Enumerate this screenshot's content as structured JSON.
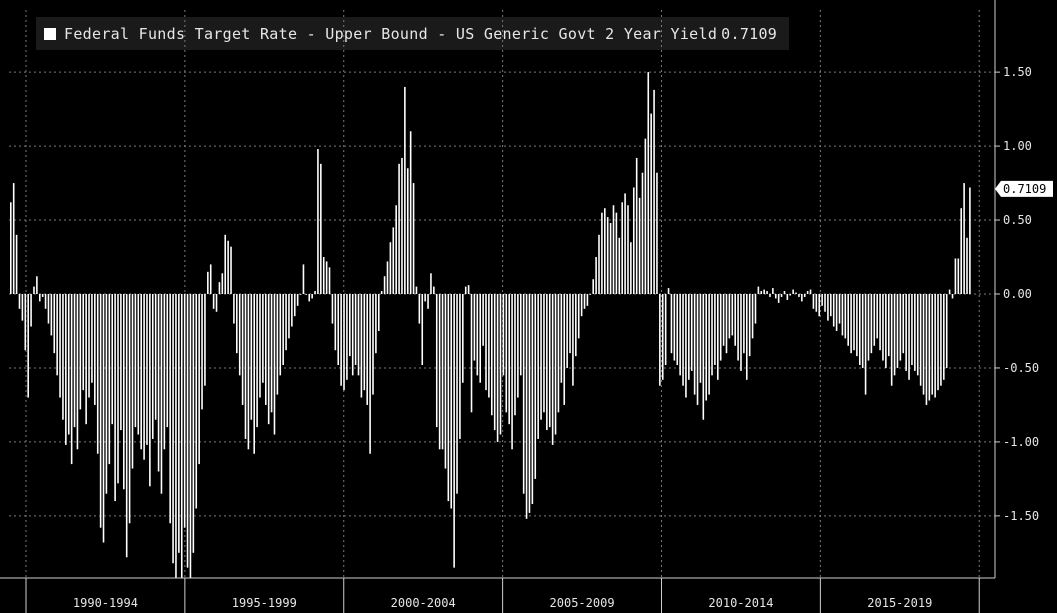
{
  "chart_data": {
    "type": "bar",
    "series": [
      {
        "name": "Federal Funds Target Rate - Upper Bound - US Generic Govt 2 Year Yield",
        "last_value": "0.7109",
        "color": "#ffffff",
        "values": [
          0.62,
          0.75,
          0.4,
          -0.1,
          -0.18,
          -0.38,
          -0.7,
          -0.22,
          0.05,
          0.12,
          -0.05,
          -0.02,
          -0.1,
          -0.2,
          -0.28,
          -0.4,
          -0.55,
          -0.7,
          -0.85,
          -1.02,
          -0.95,
          -1.15,
          -0.9,
          -1.05,
          -0.78,
          -0.65,
          -0.88,
          -0.7,
          -0.6,
          -0.75,
          -1.08,
          -1.58,
          -1.68,
          -1.35,
          -1.15,
          -0.88,
          -1.4,
          -1.28,
          -0.92,
          -1.32,
          -1.78,
          -1.55,
          -1.18,
          -0.9,
          -0.95,
          -1.05,
          -1.12,
          -1.02,
          -1.3,
          -0.98,
          -0.85,
          -1.2,
          -1.35,
          -1.05,
          -0.9,
          -1.55,
          -1.82,
          -1.92,
          -1.75,
          -1.92,
          -1.58,
          -1.85,
          -1.92,
          -1.75,
          -1.45,
          -1.15,
          -0.78,
          -0.62,
          0.15,
          0.2,
          -0.1,
          -0.12,
          0.08,
          0.14,
          0.4,
          0.36,
          0.32,
          -0.2,
          -0.4,
          -0.55,
          -0.75,
          -0.98,
          -1.05,
          -0.85,
          -1.08,
          -0.9,
          -0.7,
          -0.6,
          -0.75,
          -0.88,
          -0.8,
          -0.95,
          -0.68,
          -0.55,
          -0.48,
          -0.38,
          -0.3,
          -0.22,
          -0.15,
          -0.08,
          0.0,
          0.2,
          0.0,
          -0.05,
          -0.03,
          0.02,
          0.98,
          0.88,
          0.25,
          0.22,
          0.18,
          -0.2,
          -0.38,
          -0.48,
          -0.62,
          -0.65,
          -0.58,
          -0.42,
          -0.55,
          -0.48,
          -0.55,
          -0.7,
          -0.65,
          -0.75,
          -1.08,
          -0.68,
          -0.4,
          -0.25,
          0.02,
          0.12,
          0.22,
          0.35,
          0.45,
          0.6,
          0.88,
          0.92,
          1.4,
          0.85,
          1.1,
          0.75,
          0.05,
          -0.2,
          -0.48,
          -0.05,
          -0.1,
          0.14,
          0.05,
          -0.9,
          -1.05,
          -1.05,
          -1.18,
          -1.4,
          -1.45,
          -1.85,
          -1.35,
          -0.98,
          -0.6,
          0.05,
          0.06,
          -0.8,
          -0.45,
          -0.55,
          -0.6,
          -0.35,
          -0.65,
          -0.7,
          -0.82,
          -0.92,
          -1.0,
          -0.95,
          -0.55,
          -0.8,
          -0.88,
          -1.05,
          -0.82,
          -0.7,
          -0.55,
          -1.35,
          -1.52,
          -1.48,
          -1.42,
          -1.25,
          -0.98,
          -0.85,
          -0.8,
          -0.92,
          -0.9,
          -1.02,
          -0.95,
          -0.8,
          -0.6,
          -0.75,
          -0.5,
          -0.4,
          -0.62,
          -0.42,
          -0.3,
          -0.15,
          -0.1,
          -0.08,
          0.0,
          0.1,
          0.25,
          0.4,
          0.55,
          0.58,
          0.52,
          0.48,
          0.6,
          0.55,
          0.38,
          0.62,
          0.68,
          0.6,
          0.35,
          0.72,
          0.92,
          0.65,
          0.82,
          1.05,
          1.5,
          1.22,
          1.38,
          0.82,
          -0.62,
          -0.58,
          -0.48,
          0.04,
          -0.4,
          -0.45,
          -0.48,
          -0.55,
          -0.62,
          -0.7,
          -0.58,
          -0.52,
          -0.68,
          -0.75,
          -0.6,
          -0.85,
          -0.72,
          -0.68,
          -0.55,
          -0.48,
          -0.58,
          -0.45,
          -0.35,
          -0.4,
          -0.3,
          -0.28,
          -0.35,
          -0.45,
          -0.52,
          -0.4,
          -0.58,
          -0.42,
          -0.3,
          -0.2,
          0.05,
          0.02,
          0.03,
          0.02,
          -0.02,
          0.04,
          -0.03,
          -0.06,
          -0.02,
          0.02,
          -0.04,
          -0.01,
          0.03,
          0.01,
          -0.02,
          -0.05,
          -0.02,
          0.02,
          0.03,
          -0.1,
          -0.12,
          -0.15,
          -0.08,
          -0.12,
          -0.18,
          -0.15,
          -0.22,
          -0.25,
          -0.2,
          -0.28,
          -0.3,
          -0.35,
          -0.4,
          -0.38,
          -0.42,
          -0.48,
          -0.5,
          -0.68,
          -0.45,
          -0.4,
          -0.35,
          -0.3,
          -0.38,
          -0.45,
          -0.5,
          -0.42,
          -0.62,
          -0.55,
          -0.5,
          -0.45,
          -0.4,
          -0.52,
          -0.58,
          -0.48,
          -0.52,
          -0.55,
          -0.62,
          -0.68,
          -0.75,
          -0.72,
          -0.68,
          -0.7,
          -0.65,
          -0.62,
          -0.58,
          -0.5,
          0.03,
          -0.03,
          0.24,
          0.24,
          0.58,
          0.75,
          0.38,
          0.72
        ]
      }
    ],
    "x_axis": {
      "labels": [
        "1990-1994",
        "1995-1999",
        "2000-2004",
        "2005-2009",
        "2010-2014",
        "2015-2019"
      ]
    },
    "y_axis": {
      "ticks": [
        -1.5,
        -1.0,
        -0.5,
        0.0,
        0.5,
        1.0,
        1.5
      ],
      "tick_labels": [
        "-1.50",
        "-1.00",
        "-0.50",
        "0.00",
        "0.50",
        "1.00",
        "1.50"
      ],
      "range": [
        -1.92,
        1.92
      ],
      "position": "right"
    },
    "grid": true,
    "legend_position": "top-left",
    "background": "#000000"
  }
}
